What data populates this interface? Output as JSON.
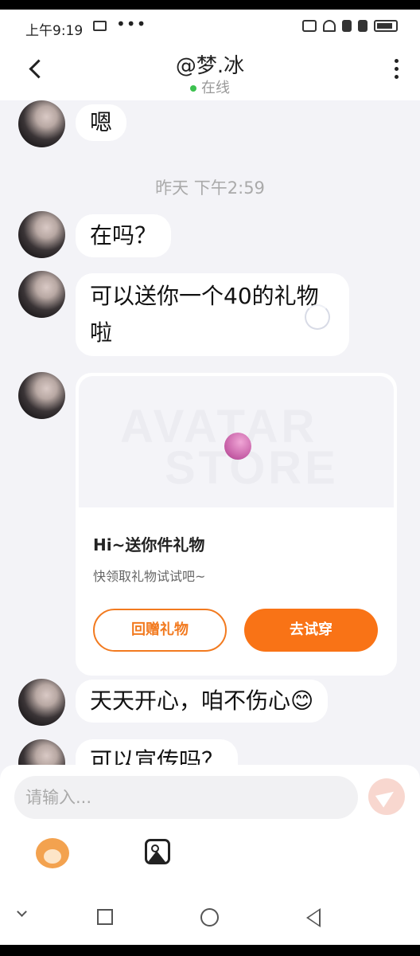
{
  "status_bar": {
    "time": "上午9:19",
    "dots": "•••"
  },
  "header": {
    "title": "@梦.冰",
    "status": "在线"
  },
  "messages": [
    {
      "text": "嗯"
    },
    {
      "text": "在吗？"
    },
    {
      "text": "可以送你一个40的礼物啦"
    },
    {
      "text": "天天开心，咱不伤心😊"
    },
    {
      "text": "可以宣传吗？"
    }
  ],
  "timestamp": "昨天 下午2:59",
  "gift_card": {
    "watermark_line1": "AVATAR",
    "watermark_line2": "STORE",
    "title": "Hi~送你件礼物",
    "subtitle": "快领取礼物试试吧~",
    "return_gift_label": "回赠礼物",
    "try_on_label": "去试穿"
  },
  "input": {
    "placeholder": "请输入..."
  },
  "colors": {
    "accent": "#f97316",
    "online": "#3cc14f",
    "background": "#f3f3f7"
  },
  "icons": [
    "folder-icon",
    "screencast-icon",
    "wifi-icon",
    "signal-icon",
    "battery-icon",
    "back-arrow-icon",
    "more-vertical-icon",
    "send-icon",
    "monkey-emoji-icon",
    "image-icon",
    "nav-down-icon",
    "nav-recents-icon",
    "nav-home-icon",
    "nav-back-icon"
  ]
}
